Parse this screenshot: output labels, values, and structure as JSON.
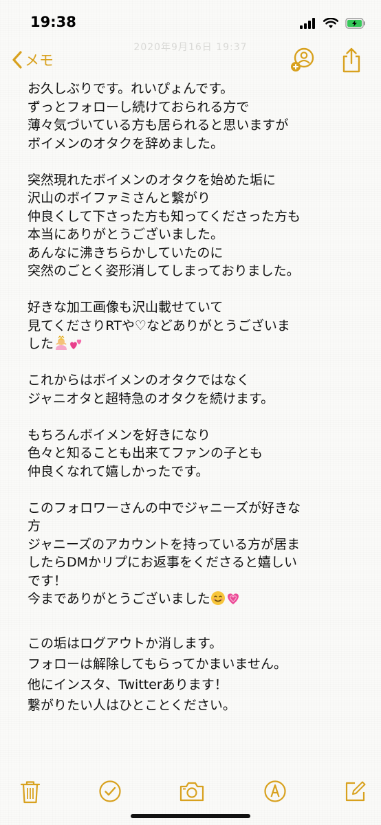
{
  "status_bar": {
    "time": "19:38"
  },
  "nav": {
    "back_label": "メモ",
    "ghost_date": "2020年9月16日 19:37"
  },
  "note": {
    "paragraphs": [
      [
        "お久しぶりです。れいぴょんです。",
        "ずっとフォローし続けておられる方で",
        "薄々気づいている方も居られると思いますが",
        "ボイメンのオタクを辞めました。"
      ],
      [
        "突然現れたボイメンのオタクを始めた垢に",
        "沢山のボイファミさんと繋がり",
        "仲良くして下さった方も知ってくださった方も",
        "本当にありがとうございました。",
        "あんなに沸きちらかしていたのに",
        "突然のごとく姿形消してしまっておりました。"
      ],
      [
        "好きな加工画像も沢山載せていて",
        "見てくださりRTや♡などありがとうございま",
        "した"
      ],
      [
        "これからはボイメンのオタクではなく",
        "ジャニオタと超特急のオタクを続けます。"
      ],
      [
        "もちろんボイメンを好きになり",
        "色々と知ることも出来てファンの子とも",
        "仲良くなれて嬉しかったです。"
      ],
      [
        "このフォロワーさんの中でジャニーズが好きな",
        "方",
        "ジャニーズのアカウントを持っている方が居ま",
        "したらDMかリプにお返事をくださると嬉しい",
        "です！",
        "今までありがとうございました"
      ]
    ],
    "tail": [
      "この垢はログアウトか消します。",
      "フォローは解除してもらってかまいません。",
      "他にインスタ、Twitterあります！",
      "繋がりたい人はひとことください。"
    ]
  },
  "colors": {
    "accent": "#d8a11e",
    "battery_fill": "#35c759"
  },
  "icons": [
    "back-chevron-icon",
    "add-person-icon",
    "share-icon",
    "trash-icon",
    "checklist-icon",
    "camera-icon",
    "markup-icon",
    "compose-icon"
  ]
}
